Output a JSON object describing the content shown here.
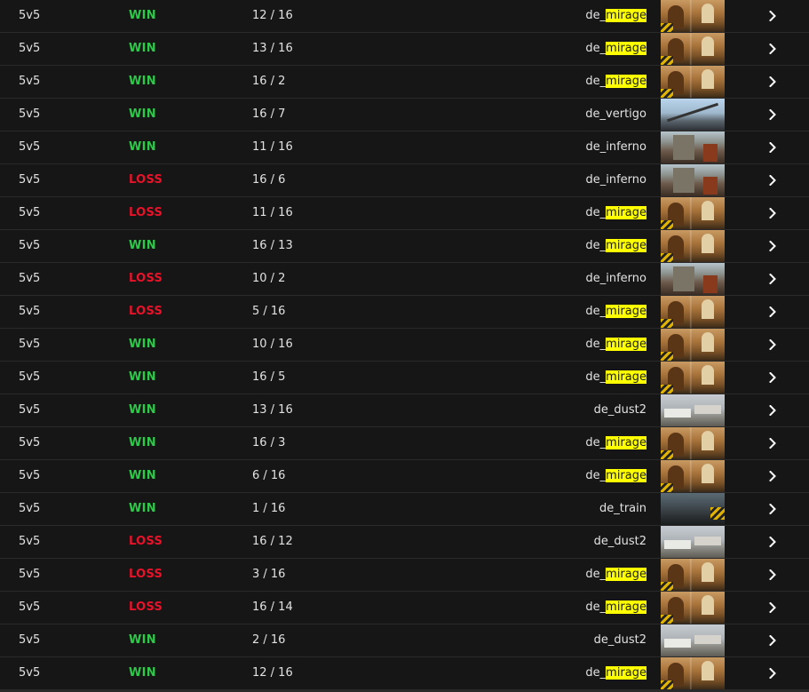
{
  "matches": [
    {
      "mode": "5v5",
      "result": "WIN",
      "score": "12 / 16",
      "map_prefix": "de_",
      "map_suffix": "mirage",
      "highlight": true,
      "map_key": "mirage"
    },
    {
      "mode": "5v5",
      "result": "WIN",
      "score": "13 / 16",
      "map_prefix": "de_",
      "map_suffix": "mirage",
      "highlight": true,
      "map_key": "mirage"
    },
    {
      "mode": "5v5",
      "result": "WIN",
      "score": "16 / 2",
      "map_prefix": "de_",
      "map_suffix": "mirage",
      "highlight": true,
      "map_key": "mirage"
    },
    {
      "mode": "5v5",
      "result": "WIN",
      "score": "16 / 7",
      "map_prefix": "de_vertigo",
      "map_suffix": "",
      "highlight": false,
      "map_key": "vertigo"
    },
    {
      "mode": "5v5",
      "result": "WIN",
      "score": "11 / 16",
      "map_prefix": "de_inferno",
      "map_suffix": "",
      "highlight": false,
      "map_key": "inferno"
    },
    {
      "mode": "5v5",
      "result": "LOSS",
      "score": "16 / 6",
      "map_prefix": "de_inferno",
      "map_suffix": "",
      "highlight": false,
      "map_key": "inferno"
    },
    {
      "mode": "5v5",
      "result": "LOSS",
      "score": "11 / 16",
      "map_prefix": "de_",
      "map_suffix": "mirage",
      "highlight": true,
      "map_key": "mirage"
    },
    {
      "mode": "5v5",
      "result": "WIN",
      "score": "16 / 13",
      "map_prefix": "de_",
      "map_suffix": "mirage",
      "highlight": true,
      "map_key": "mirage"
    },
    {
      "mode": "5v5",
      "result": "LOSS",
      "score": "10 / 2",
      "map_prefix": "de_inferno",
      "map_suffix": "",
      "highlight": false,
      "map_key": "inferno"
    },
    {
      "mode": "5v5",
      "result": "LOSS",
      "score": "5 / 16",
      "map_prefix": "de_",
      "map_suffix": "mirage",
      "highlight": true,
      "map_key": "mirage"
    },
    {
      "mode": "5v5",
      "result": "WIN",
      "score": "10 / 16",
      "map_prefix": "de_",
      "map_suffix": "mirage",
      "highlight": true,
      "map_key": "mirage"
    },
    {
      "mode": "5v5",
      "result": "WIN",
      "score": "16 / 5",
      "map_prefix": "de_",
      "map_suffix": "mirage",
      "highlight": true,
      "map_key": "mirage"
    },
    {
      "mode": "5v5",
      "result": "WIN",
      "score": "13 / 16",
      "map_prefix": "de_dust2",
      "map_suffix": "",
      "highlight": false,
      "map_key": "dust2"
    },
    {
      "mode": "5v5",
      "result": "WIN",
      "score": "16 / 3",
      "map_prefix": "de_",
      "map_suffix": "mirage",
      "highlight": true,
      "map_key": "mirage"
    },
    {
      "mode": "5v5",
      "result": "WIN",
      "score": "6 / 16",
      "map_prefix": "de_",
      "map_suffix": "mirage",
      "highlight": true,
      "map_key": "mirage"
    },
    {
      "mode": "5v5",
      "result": "WIN",
      "score": "1 / 16",
      "map_prefix": "de_train",
      "map_suffix": "",
      "highlight": false,
      "map_key": "train"
    },
    {
      "mode": "5v5",
      "result": "LOSS",
      "score": "16 / 12",
      "map_prefix": "de_dust2",
      "map_suffix": "",
      "highlight": false,
      "map_key": "dust2"
    },
    {
      "mode": "5v5",
      "result": "LOSS",
      "score": "3 / 16",
      "map_prefix": "de_",
      "map_suffix": "mirage",
      "highlight": true,
      "map_key": "mirage"
    },
    {
      "mode": "5v5",
      "result": "LOSS",
      "score": "16 / 14",
      "map_prefix": "de_",
      "map_suffix": "mirage",
      "highlight": true,
      "map_key": "mirage"
    },
    {
      "mode": "5v5",
      "result": "WIN",
      "score": "2 / 16",
      "map_prefix": "de_dust2",
      "map_suffix": "",
      "highlight": false,
      "map_key": "dust2"
    },
    {
      "mode": "5v5",
      "result": "WIN",
      "score": "12 / 16",
      "map_prefix": "de_",
      "map_suffix": "mirage",
      "highlight": true,
      "map_key": "mirage"
    }
  ],
  "colors": {
    "win": "#2ec84a",
    "loss": "#e8122a",
    "row_background": "#161616",
    "divider": "#2a2a2a",
    "search_highlight": "#ffff00"
  },
  "icons": {
    "row_action": "chevron-right-icon"
  }
}
